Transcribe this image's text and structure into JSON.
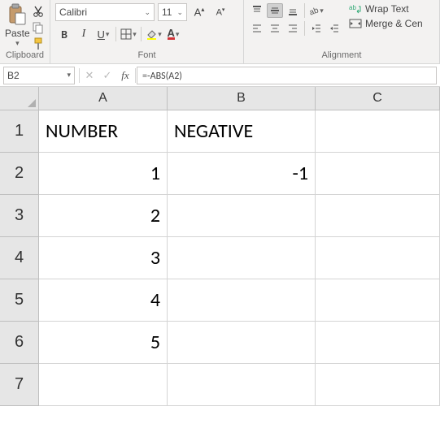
{
  "ribbon": {
    "clipboard": {
      "label": "Clipboard",
      "paste": "Paste"
    },
    "font": {
      "label": "Font",
      "name": "Calibri",
      "size": "11",
      "bold": "B",
      "italic": "I",
      "underline": "U"
    },
    "alignment": {
      "label": "Alignment",
      "wrap": "Wrap Text",
      "merge": "Merge & Cen"
    }
  },
  "formula_bar": {
    "cell_ref": "B2",
    "formula": "=-ABS(A2)"
  },
  "grid": {
    "columns": [
      "A",
      "B",
      "C"
    ],
    "rows": [
      "1",
      "2",
      "3",
      "4",
      "5",
      "6",
      "7"
    ],
    "data": {
      "A1": "NUMBER",
      "B1": "NEGATIVE",
      "A2": "1",
      "B2": "-1",
      "A3": "2",
      "A4": "3",
      "A5": "4",
      "A6": "5"
    }
  }
}
